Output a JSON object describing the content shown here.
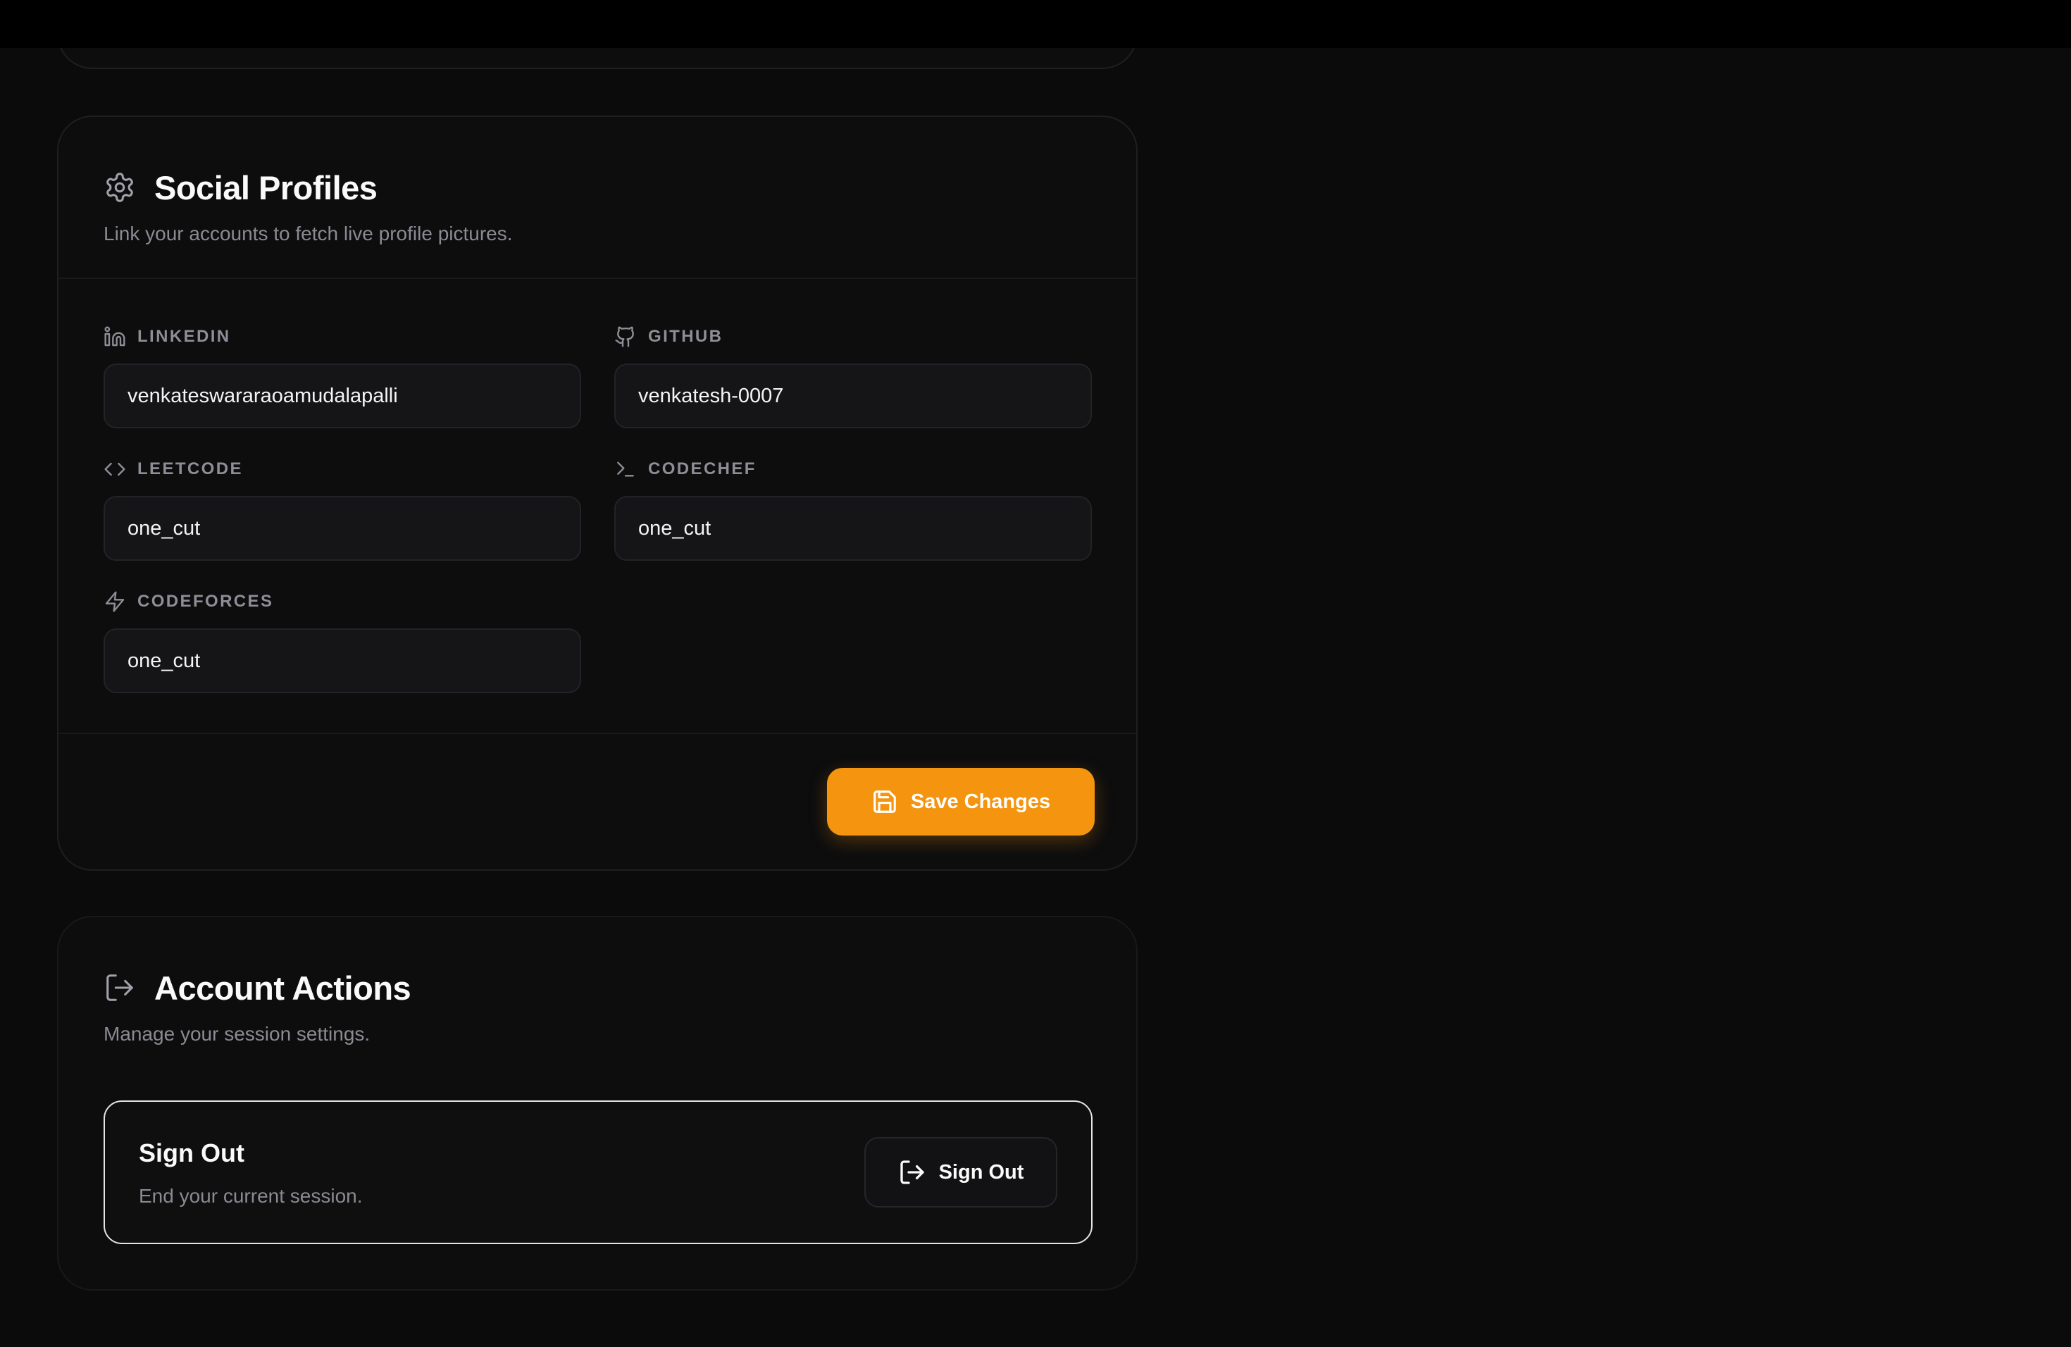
{
  "social": {
    "title": "Social Profiles",
    "subtitle": "Link your accounts to fetch live profile pictures.",
    "title_icon": "gear-icon",
    "fields": {
      "linkedin": {
        "label": "LINKEDIN",
        "value": "venkateswararaoamudalapalli",
        "icon": "linkedin-icon"
      },
      "github": {
        "label": "GITHUB",
        "value": "venkatesh-0007",
        "icon": "github-icon"
      },
      "leetcode": {
        "label": "LEETCODE",
        "value": "one_cut",
        "icon": "code-brackets-icon"
      },
      "codechef": {
        "label": "CODECHEF",
        "value": "one_cut",
        "icon": "terminal-icon"
      },
      "codeforces": {
        "label": "CODEFORCES",
        "value": "one_cut",
        "icon": "lightning-icon"
      }
    },
    "save_label": "Save Changes",
    "save_icon": "save-icon"
  },
  "account": {
    "title": "Account Actions",
    "subtitle": "Manage your session settings.",
    "title_icon": "log-out-icon",
    "signout": {
      "title": "Sign Out",
      "description": "End your current session.",
      "button_label": "Sign Out"
    }
  },
  "colors": {
    "accent": "#f4940f",
    "background": "#0b0b0c",
    "card": "#0d0d0e"
  }
}
